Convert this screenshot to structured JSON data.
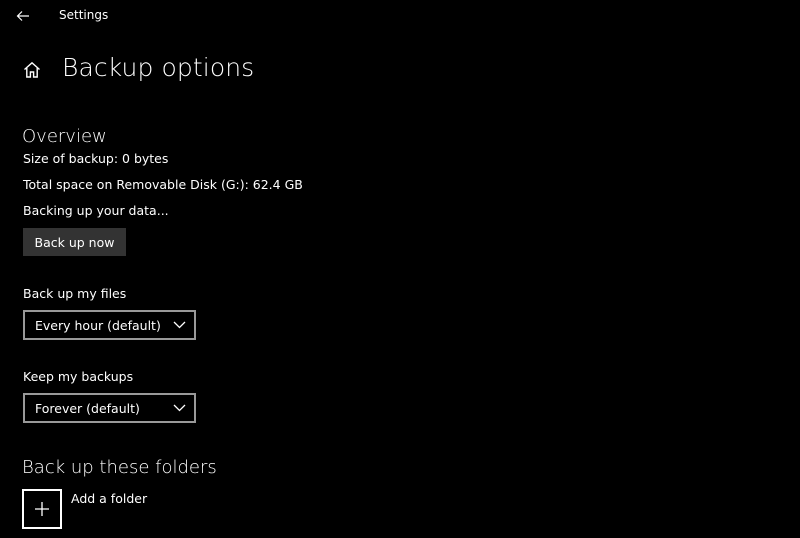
{
  "window": {
    "app_title": "Settings"
  },
  "header": {
    "title": "Backup options"
  },
  "overview": {
    "heading": "Overview",
    "size_text": "Size of backup: 0 bytes",
    "space_text": "Total space on Removable Disk (G:): 62.4 GB",
    "status_text": "Backing up your data...",
    "backup_now_label": "Back up now"
  },
  "backup_frequency": {
    "label": "Back up my files",
    "selected": "Every hour (default)"
  },
  "retention": {
    "label": "Keep my backups",
    "selected": "Forever (default)"
  },
  "folders": {
    "heading": "Back up these folders",
    "add_label": "Add a folder"
  },
  "icons": {
    "back": "arrow-left-icon",
    "home": "home-icon",
    "chevron": "chevron-down-icon",
    "add": "plus-icon"
  },
  "colors": {
    "background": "#000000",
    "text": "#ffffff",
    "button_bg": "#333333",
    "dropdown_border": "#999999"
  }
}
